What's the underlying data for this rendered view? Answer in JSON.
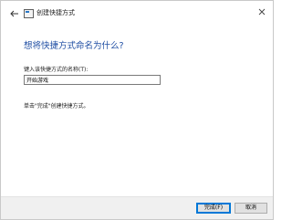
{
  "window": {
    "title": "创建快捷方式"
  },
  "main": {
    "heading": "想将快捷方式命名为什么?",
    "field_label": "键入该快捷方式的名称(T):",
    "name_value": "开始游戏",
    "hint": "单击\"完成\"创建快捷方式。"
  },
  "footer": {
    "finish_label": "完成(F)",
    "cancel_label": "取消"
  },
  "icons": {
    "back": "back-arrow-icon",
    "close": "close-icon",
    "wizard": "shortcut-wizard-icon"
  },
  "colors": {
    "heading": "#1f4ea3",
    "accent": "#0078d7"
  }
}
